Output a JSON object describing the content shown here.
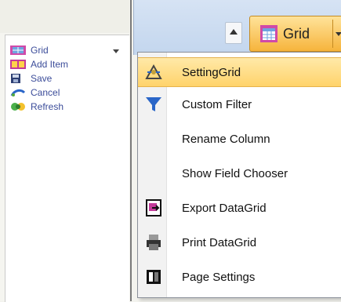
{
  "left_toolbar": {
    "items": [
      {
        "label": "Grid",
        "icon": "grid-icon"
      },
      {
        "label": "Add Item",
        "icon": "add-item-icon"
      },
      {
        "label": "Save",
        "icon": "save-icon"
      },
      {
        "label": "Cancel",
        "icon": "cancel-icon"
      },
      {
        "label": "Refresh",
        "icon": "refresh-icon"
      }
    ]
  },
  "top_toolbar": {
    "grid_label": "Grid"
  },
  "menu": {
    "items": [
      {
        "label": "SettingGrid",
        "icon": "settings-icon",
        "highlighted": true
      },
      {
        "label": "Custom Filter",
        "icon": "filter-icon"
      },
      {
        "label": "Rename Column",
        "icon": ""
      },
      {
        "label": "Show Field Chooser",
        "icon": ""
      },
      {
        "label": "Export DataGrid",
        "icon": "export-icon"
      },
      {
        "label": "Print DataGrid",
        "icon": "print-icon"
      },
      {
        "label": "Page Settings",
        "icon": "page-settings-icon"
      }
    ]
  },
  "colors": {
    "accent": "#f6b43c",
    "highlight": "#ffd36b",
    "link_text": "#3c4d9a"
  }
}
